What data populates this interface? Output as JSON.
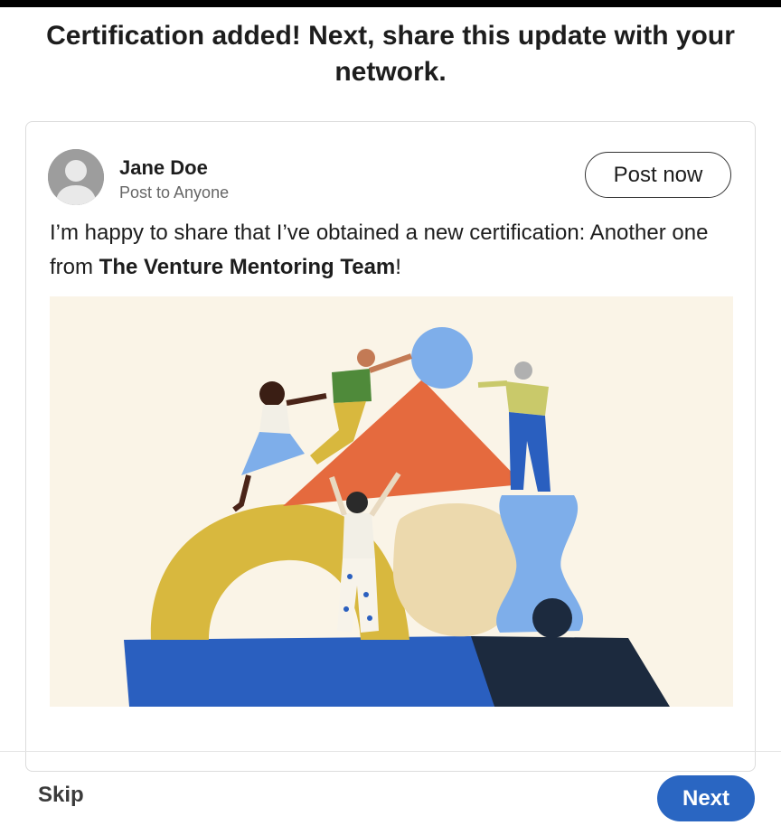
{
  "dialog": {
    "headline": "Certification added! Next, share this update with your network."
  },
  "post": {
    "author_name": "Jane Doe",
    "audience": "Post to Anyone",
    "post_now_label": "Post now",
    "text_prefix": "I’m happy to share that I’ve obtained a new certification: Another one from ",
    "text_bold": "The Venture Mentoring Team",
    "text_suffix": "!",
    "avatar_icon": "person-silhouette-icon",
    "illustration_icon": "team-building-shapes-illustration"
  },
  "footer": {
    "skip_label": "Skip",
    "next_label": "Next"
  },
  "colors": {
    "primary": "#2a66c2",
    "illustration_bg": "#faf4e7"
  }
}
